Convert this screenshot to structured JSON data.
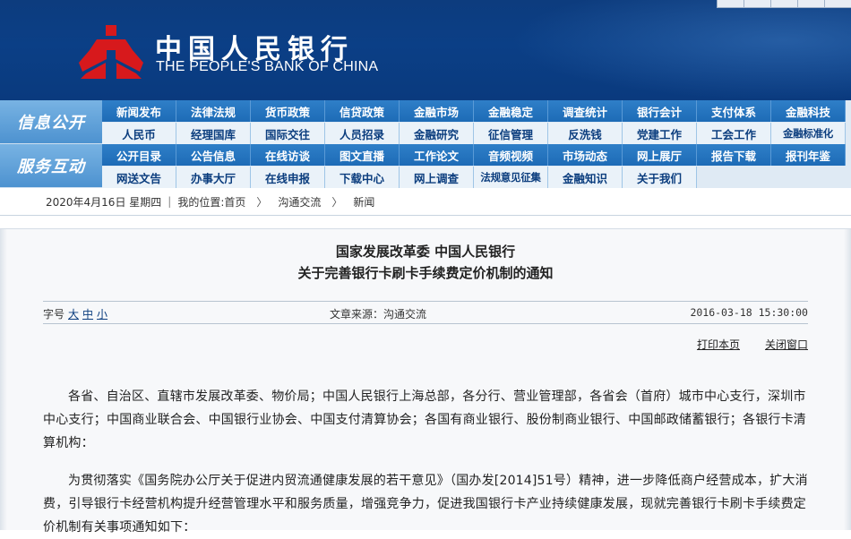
{
  "header": {
    "bank_name_cn": "中国人民银行",
    "bank_name_en": "THE PEOPLE'S BANK OF CHINA",
    "logo_icon": "pboc-logo-icon",
    "colors": {
      "header_bg": "#0b3f86",
      "logo_red": "#d7191c",
      "nav_blue": "#1d6bb6"
    }
  },
  "nav": {
    "info": {
      "label": "信息公开",
      "row1": [
        "新闻发布",
        "法律法规",
        "货币政策",
        "信贷政策",
        "金融市场",
        "金融稳定",
        "调查统计",
        "银行会计",
        "支付体系",
        "金融科技"
      ],
      "row2": [
        "人民币",
        "经理国库",
        "国际交往",
        "人员招录",
        "金融研究",
        "征信管理",
        "反洗钱",
        "党建工作",
        "工会工作",
        "金融标准化"
      ]
    },
    "service": {
      "label": "服务互动",
      "row1": [
        "公开目录",
        "公告信息",
        "在线访谈",
        "图文直播",
        "工作论文",
        "音频视频",
        "市场动态",
        "网上展厅",
        "报告下载",
        "报刊年鉴"
      ],
      "row2": [
        "网送文告",
        "办事大厅",
        "在线申报",
        "下载中心",
        "网上调查",
        "法规意见征集",
        "金融知识",
        "关于我们"
      ]
    }
  },
  "breadcrumb": {
    "date": "2020年4月16日 星期四",
    "location_label": "我的位置:",
    "home": "首页",
    "level1": "沟通交流",
    "level2": "新闻",
    "arrow": "〉"
  },
  "article": {
    "title_line1": "国家发展改革委  中国人民银行",
    "title_line2": "关于完善银行卡刷卡手续费定价机制的通知",
    "font_size_label": "字号",
    "font_size_large": "大",
    "font_size_medium": "中",
    "font_size_small": "小",
    "source": "文章来源：沟通交流",
    "datetime": "2016-03-18 15:30:00",
    "print_label": "打印本页",
    "close_label": "关闭窗口",
    "paragraph1": "各省、自治区、直辖市发展改革委、物价局；中国人民银行上海总部，各分行、营业管理部，各省会（首府）城市中心支行，深圳市中心支行；中国商业联合会、中国银行业协会、中国支付清算协会；各国有商业银行、股份制商业银行、中国邮政储蓄银行；各银行卡清算机构：",
    "paragraph2": "为贯彻落实《国务院办公厅关于促进内贸流通健康发展的若干意见》（国办发[2014]51号）精神，进一步降低商户经营成本，扩大消费，引导银行卡经营机构提升经营管理水平和服务质量，增强竞争力，促进我国银行卡产业持续健康发展，现就完善银行卡刷卡手续费定价机制有关事项通知如下："
  }
}
